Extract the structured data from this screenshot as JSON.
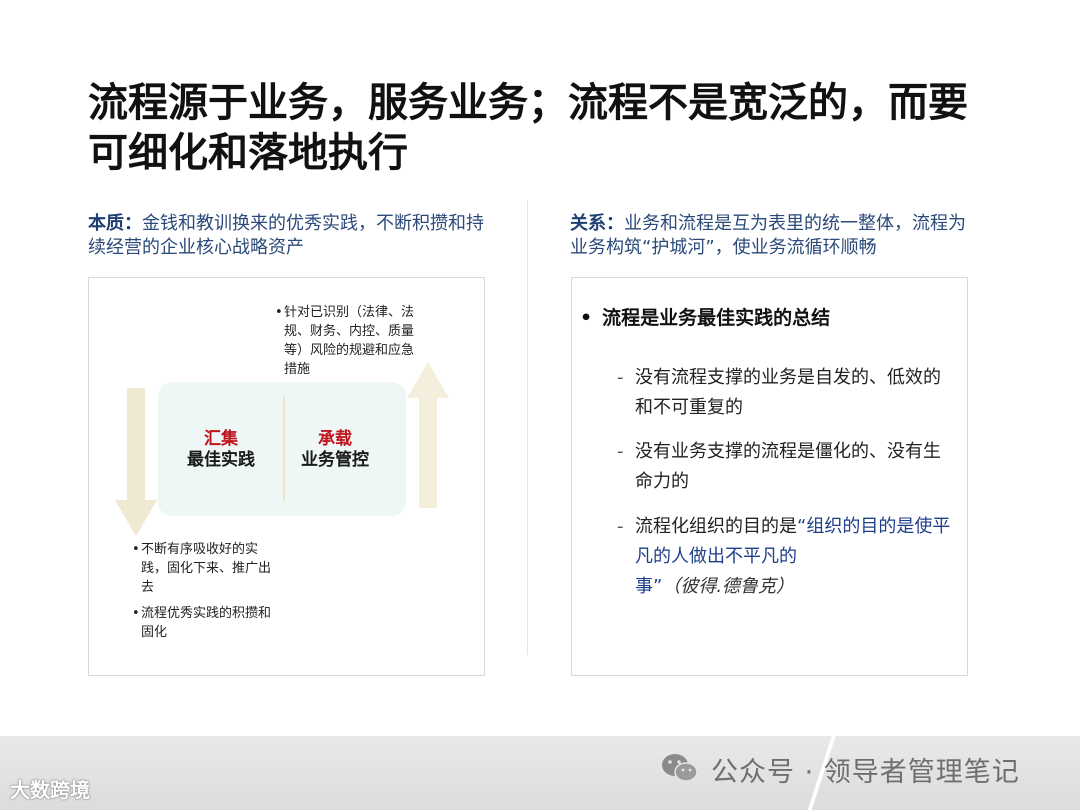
{
  "title": "流程源于业务，服务业务；流程不是宽泛的，而要可细化和落地执行",
  "left": {
    "label": "本质：",
    "text": "金钱和教训换来的优秀实践，不断积攒和持续经营的企业核心战略资产",
    "card": {
      "left_red": "汇集",
      "left_black": "最佳实践",
      "right_red": "承载",
      "right_black": "业务管控"
    },
    "top_note": "针对已识别（法律、法规、财务、内控、质量等）风险的规避和应急措施",
    "bottom_notes": [
      "不断有序吸收好的实践，固化下来、推广出去",
      "流程优秀实践的积攒和固化"
    ]
  },
  "right": {
    "label": "关系：",
    "text": "业务和流程是互为表里的统一整体，流程为业务构筑“护城河”，使业务流循环顺畅",
    "heading": "流程是业务最佳实践的总结",
    "items": [
      "没有流程支撑的业务是自发的、低效的和不可重复的",
      "没有业务支撑的流程是僵化的、没有生命力的"
    ],
    "item3_prefix": "流程化组织的目的是",
    "item3_quote": "“组织的目的是使平凡的人做出不平凡的事”",
    "item3_cite": "（彼得.德鲁克）"
  },
  "footer": {
    "watermark": "公众号 · 领导者管理笔记",
    "logo_text": "大数跨境"
  },
  "colors": {
    "accent_blue": "#1f3f73",
    "accent_red": "#c0141c",
    "arrow_beige": "#efe9d2",
    "card_bg": "#eef6f6"
  },
  "icons": [
    "arrow-down-icon",
    "arrow-up-icon",
    "wechat-icon",
    "brand-logo-icon"
  ]
}
